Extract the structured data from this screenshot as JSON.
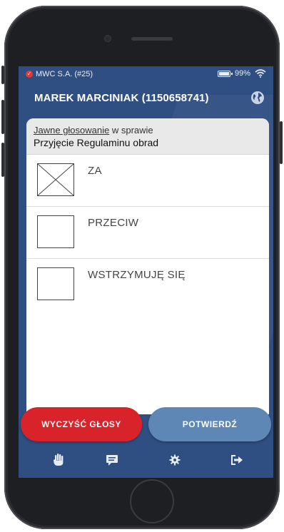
{
  "statusbar": {
    "carrier": "MWC S.A. (#25)",
    "battery": "99%"
  },
  "header": {
    "title": "MAREK MARCINIAK (1150658741)"
  },
  "vote": {
    "mode_link": "Jawne głosowanie",
    "mode_suffix": " w sprawie",
    "subject": "Przyjęcie Regulaminu obrad",
    "options": [
      {
        "label": "ZA",
        "checked": true
      },
      {
        "label": "PRZECIW",
        "checked": false
      },
      {
        "label": "WSTRZYMUJĘ SIĘ",
        "checked": false
      }
    ]
  },
  "actions": {
    "clear": "WYCZYŚĆ GŁOSY",
    "confirm": "POTWIERDŹ"
  },
  "tabbar": {
    "icons": [
      "hand-icon",
      "chat-icon",
      "gear-icon",
      "logout-icon"
    ]
  },
  "colors": {
    "screen_bg": "#2f4f82",
    "accent_red": "#d9232a",
    "accent_blue": "#5e87b6"
  }
}
